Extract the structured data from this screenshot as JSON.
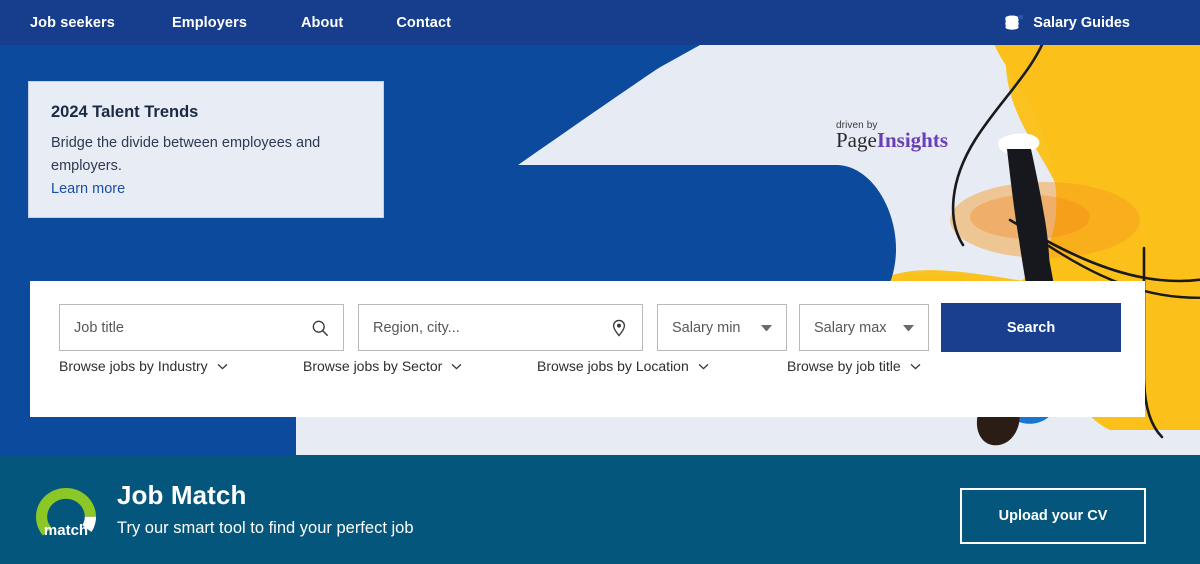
{
  "nav": {
    "links": [
      {
        "label": "Job seekers"
      },
      {
        "label": "Employers"
      },
      {
        "label": "About"
      },
      {
        "label": "Contact"
      }
    ],
    "salary_guides": {
      "label": "Salary Guides",
      "icon": "coins-stack-icon"
    },
    "background_color": "#173e8c"
  },
  "hero": {
    "background_color": "#e7ebf4",
    "blue_shape_color": "#0b4a9c",
    "accent_yellow": "#fbc11a",
    "trends_card": {
      "title": "2024 Talent Trends",
      "description": "Bridge the divide between employees and employers.",
      "link_label": "Learn more",
      "background_color": "#e8ecf5"
    },
    "partner_logo": {
      "driven_by": "driven by",
      "brand_first": "Page",
      "brand_second": "Insights",
      "brand_second_color": "#6a3fb5"
    },
    "illustration": {
      "description": "upside-down person in blue shirt with yellow organic shapes and black curved lines"
    }
  },
  "search": {
    "job_title": {
      "placeholder": "Job title",
      "value": "",
      "icon": "search-icon"
    },
    "region": {
      "placeholder": "Region, city...",
      "value": "",
      "icon": "location-pin-icon"
    },
    "salary_min": {
      "label": "Salary min",
      "icon": "chevron-down-icon"
    },
    "salary_max": {
      "label": "Salary max",
      "icon": "chevron-down-icon"
    },
    "search_button": {
      "label": "Search",
      "color": "#1b3f8f"
    },
    "browse": [
      {
        "label": "Browse jobs by Industry",
        "icon": "chevron-down-icon"
      },
      {
        "label": "Browse jobs by Sector",
        "icon": "chevron-down-icon"
      },
      {
        "label": "Browse jobs by Location",
        "icon": "chevron-down-icon"
      },
      {
        "label": "Browse by job title",
        "icon": "chevron-down-icon"
      }
    ]
  },
  "job_match": {
    "title": "Job Match",
    "subtitle": "Try our smart tool to find your perfect job",
    "logo_label": "match",
    "logo_color": "#8bc727",
    "upload_button": "Upload your CV",
    "background_color": "#04567c"
  }
}
